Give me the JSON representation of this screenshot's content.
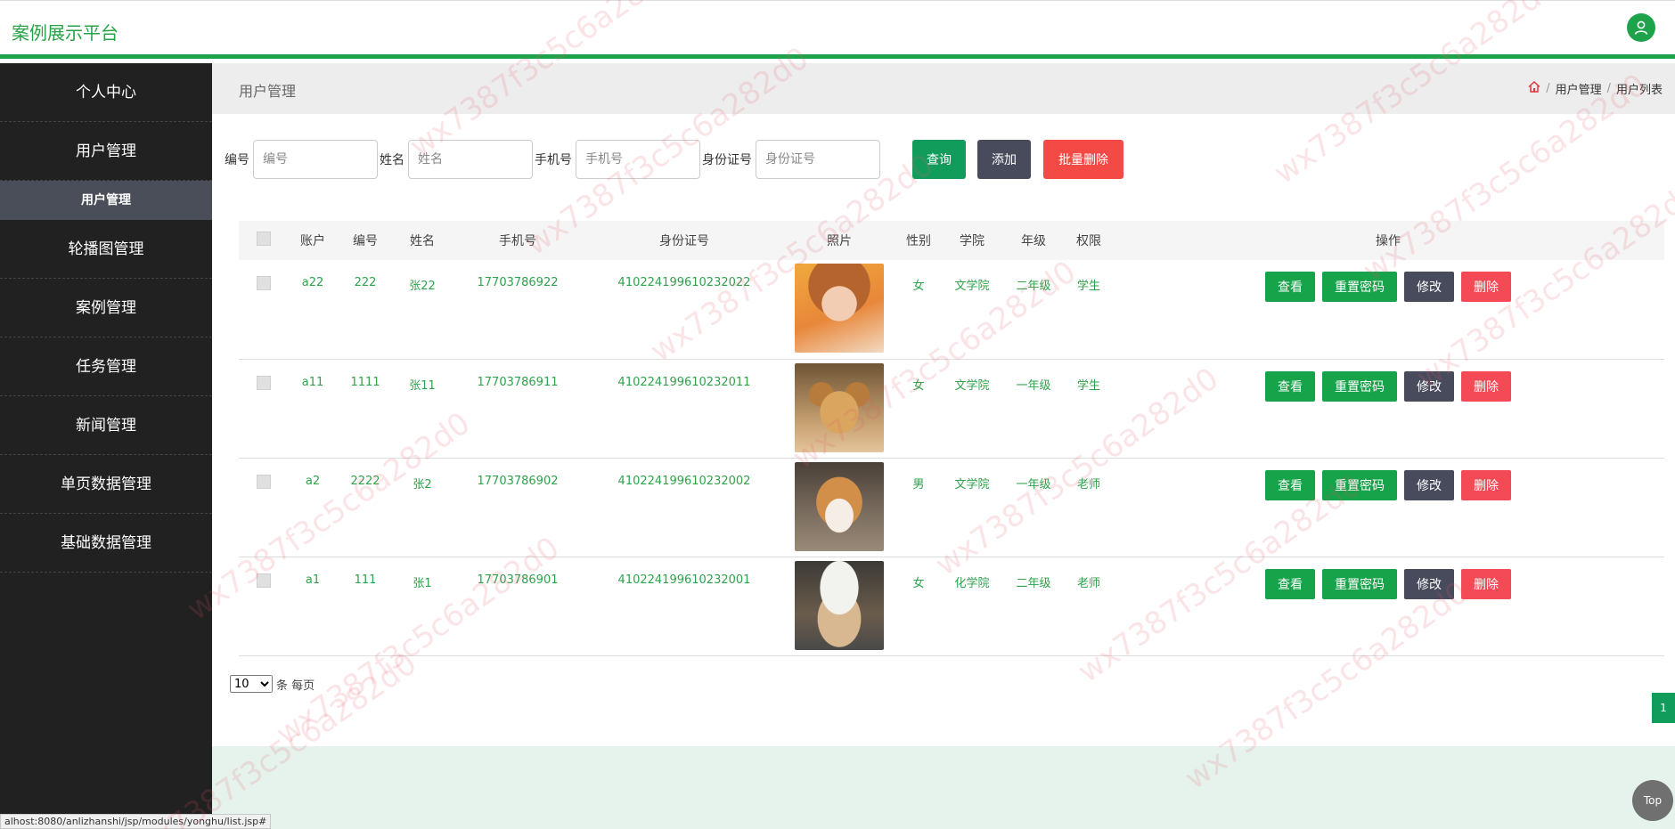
{
  "header": {
    "brand": "案例展示平台",
    "user_icon": "user-icon"
  },
  "sidebar": {
    "items": [
      {
        "label": "个人中心"
      },
      {
        "label": "用户管理"
      },
      {
        "label": "用户管理",
        "sub": true
      },
      {
        "label": "轮播图管理"
      },
      {
        "label": "案例管理"
      },
      {
        "label": "任务管理"
      },
      {
        "label": "新闻管理"
      },
      {
        "label": "单页数据管理"
      },
      {
        "label": "基础数据管理"
      }
    ]
  },
  "page": {
    "title": "用户管理",
    "breadcrumb": [
      "用户管理",
      "用户列表"
    ],
    "home_icon": "home-icon"
  },
  "search": {
    "fields": [
      {
        "label": "编号",
        "placeholder": "编号",
        "value": ""
      },
      {
        "label": "姓名",
        "placeholder": "姓名",
        "value": ""
      },
      {
        "label": "手机号",
        "placeholder": "手机号",
        "value": ""
      },
      {
        "label": "身份证号",
        "placeholder": "身份证号",
        "value": ""
      }
    ],
    "query_label": "查询",
    "add_label": "添加",
    "batch_delete_label": "批量删除"
  },
  "table": {
    "headers": [
      "",
      "账户",
      "编号",
      "姓名",
      "手机号",
      "身份证号",
      "照片",
      "性别",
      "学院",
      "年级",
      "权限",
      "操作"
    ],
    "op_labels": {
      "view": "查看",
      "reset": "重置密码",
      "edit": "修改",
      "delete": "删除"
    },
    "rows": [
      {
        "account": "a22",
        "number": "222",
        "name": "张22",
        "phone": "17703786922",
        "id_card": "410224199610232022",
        "photo": "girl-photo",
        "gender": "女",
        "college": "文学院",
        "grade": "二年级",
        "role": "学生"
      },
      {
        "account": "a11",
        "number": "1111",
        "name": "张11",
        "phone": "17703786911",
        "id_card": "410224199610232011",
        "photo": "puppy-photo",
        "gender": "女",
        "college": "文学院",
        "grade": "一年级",
        "role": "学生"
      },
      {
        "account": "a2",
        "number": "2222",
        "name": "张2",
        "phone": "17703786902",
        "id_card": "410224199610232002",
        "photo": "shiba-photo",
        "gender": "男",
        "college": "文学院",
        "grade": "一年级",
        "role": "老师"
      },
      {
        "account": "a1",
        "number": "111",
        "name": "张1",
        "phone": "17703786901",
        "id_card": "410224199610232001",
        "photo": "cat-photo",
        "gender": "女",
        "college": "化学院",
        "grade": "二年级",
        "role": "老师"
      }
    ]
  },
  "pagination": {
    "page_size": "10",
    "page_size_suffix": "条 每页",
    "current_page": "1"
  },
  "top_button": "Top",
  "status_url": "alhost:8080/anlizhanshi/jsp/modules/yonghu/list.jsp#",
  "watermark": "wx7387f3c5c6a282d0",
  "colors": {
    "accent": "#1fa34a",
    "sidebar": "#212121",
    "danger": "#f44a45",
    "dark_button": "#474b5c"
  }
}
